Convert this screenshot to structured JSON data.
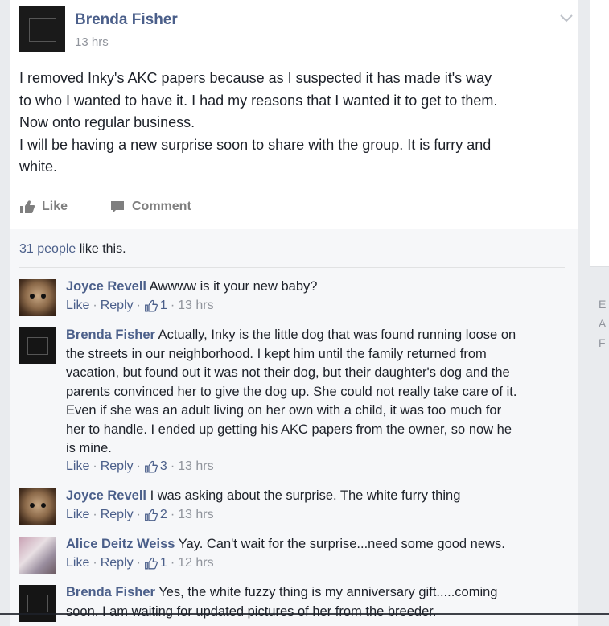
{
  "post": {
    "author": "Brenda Fisher",
    "time": "13 hrs",
    "body_lines": [
      "I removed Inky's AKC papers because as I suspected it has made it's way",
      "to who I wanted to have it. I had my reasons that I wanted it to get to them.",
      "Now onto regular business.",
      "I will be having a new surprise soon to share with the group. It is furry and",
      "white."
    ],
    "actions": {
      "like": "Like",
      "comment": "Comment"
    },
    "likes_link": "31 people",
    "likes_suffix": " like this."
  },
  "comments": [
    {
      "name": "Joyce Revell",
      "lines": [
        " Awwww is it your new baby?"
      ],
      "like": "Like",
      "reply": "Reply",
      "count": "1",
      "time": "13 hrs"
    },
    {
      "name": "Brenda Fisher",
      "lines": [
        " Actually, Inky is the little dog that was found running loose on",
        "the streets in our neighborhood. I kept him until the family returned from",
        "vacation, but found out it was not their dog, but their daughter's dog and the",
        "parents convinced her to give the dog up. She could not really take care of it.",
        "Even if she was an adult living on her own with a child, it was too much for",
        "her to handle. I ended up getting his AKC papers from the owner, so now he",
        "is mine."
      ],
      "like": "Like",
      "reply": "Reply",
      "count": "3",
      "time": "13 hrs"
    },
    {
      "name": "Joyce Revell",
      "lines": [
        " I was asking about the surprise. The white furry thing"
      ],
      "like": "Like",
      "reply": "Reply",
      "count": "2",
      "time": "13 hrs"
    },
    {
      "name": "Alice Deitz Weiss",
      "lines": [
        " Yay. Can't wait for the surprise...need some good news."
      ],
      "like": "Like",
      "reply": "Reply",
      "count": "1",
      "time": "12 hrs"
    },
    {
      "name": "Brenda Fisher",
      "lines": [
        " Yes, the white fuzzy thing is my anniversary gift.....coming",
        "soon. I am waiting for updated pictures of her from the breeder."
      ]
    }
  ],
  "sidebar": {
    "letters": [
      "E",
      "A",
      "F"
    ]
  },
  "colors": {
    "link": "#4b5f8a",
    "meta": "#90949c",
    "text": "#1d2129"
  },
  "icons": [
    "chevron-down-icon",
    "thumbs-up-icon",
    "comment-icon",
    "like-count-icon"
  ]
}
